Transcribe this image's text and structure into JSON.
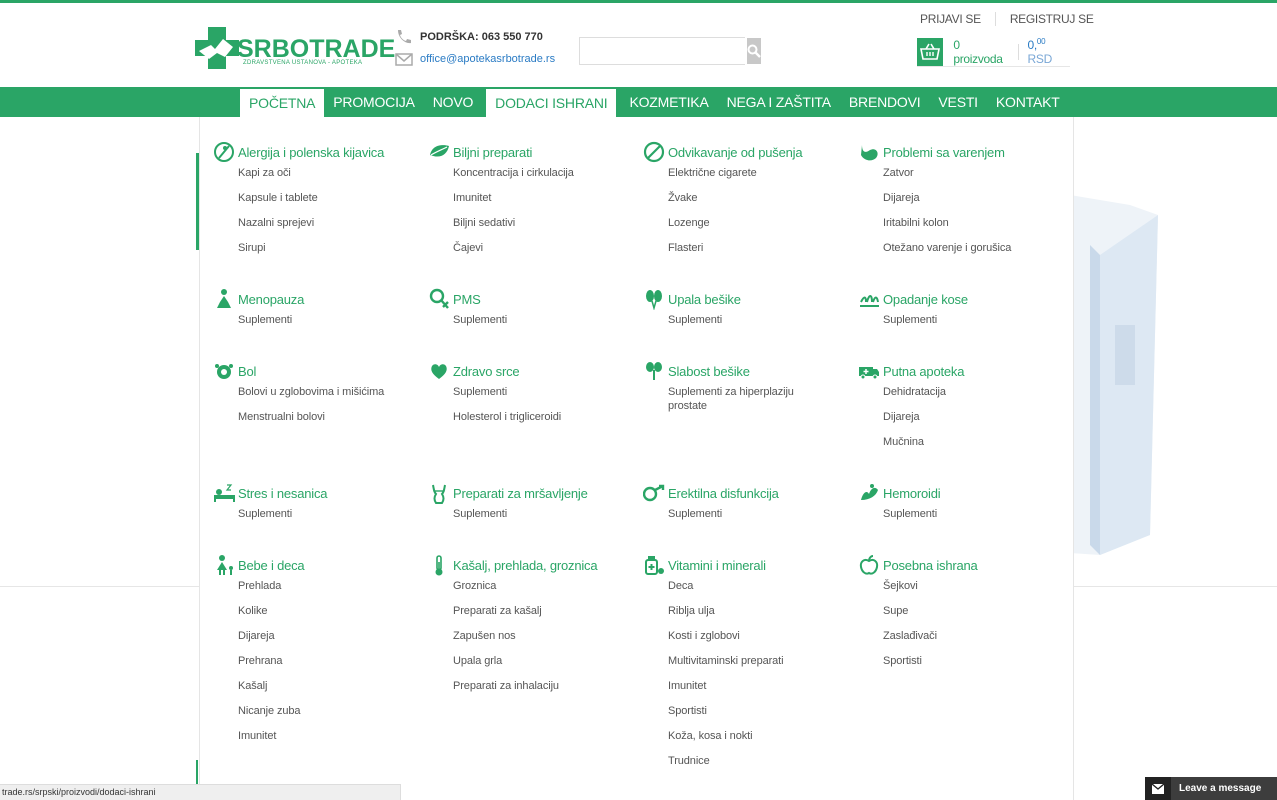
{
  "brand": {
    "name": "SRBOTRADE",
    "tagline": "ZDRAVSTVENA USTANOVA - APOTEKA"
  },
  "contact": {
    "support": "PODRŠKA: 063 550 770",
    "email": "office@apotekasrbotrade.rs"
  },
  "search": {
    "placeholder": ""
  },
  "auth": {
    "login": "PRIJAVI SE",
    "register": "REGISTRUJ SE"
  },
  "cart": {
    "count": "0 proizvoda",
    "price_int": "0,",
    "price_dec": "00",
    "currency": "RSD"
  },
  "nav": [
    "POČETNA",
    "PROMOCIJA",
    "NOVO",
    "DODACI ISHRANI",
    "KOZMETIKA",
    "NEGA I ZAŠTITA",
    "BRENDOVI",
    "VESTI",
    "KONTAKT"
  ],
  "categories": [
    {
      "title": "Alergija i polenska kijavica",
      "icon": "no-allergy-icon",
      "items": [
        "Kapi za oči",
        "Kapsule i tablete",
        "Nazalni sprejevi",
        "Sirupi"
      ]
    },
    {
      "title": "Biljni preparati",
      "icon": "leaf-icon",
      "items": [
        "Koncentracija i cirkulacija",
        "Imunitet",
        "Biljni sedativi",
        "Čajevi"
      ]
    },
    {
      "title": "Odvikavanje od pušenja",
      "icon": "no-smoking-icon",
      "items": [
        "Električne cigarete",
        "Žvake",
        "Lozenge",
        "Flasteri"
      ]
    },
    {
      "title": "Problemi sa varenjem",
      "icon": "stomach-icon",
      "items": [
        "Zatvor",
        "Dijareja",
        "Iritabilni kolon",
        "Otežano varenje i gorušica"
      ]
    },
    {
      "title": "Menopauza",
      "icon": "woman-icon",
      "items": [
        "Suplementi"
      ]
    },
    {
      "title": "PMS",
      "icon": "female-symbol-icon",
      "items": [
        "Suplementi"
      ]
    },
    {
      "title": "Upala bešike",
      "icon": "kidney-icon",
      "items": [
        "Suplementi"
      ]
    },
    {
      "title": "Opadanje kose",
      "icon": "hair-icon",
      "items": [
        "Suplementi"
      ]
    },
    {
      "title": "Bol",
      "icon": "pain-icon",
      "items": [
        "Bolovi u zglobovima i mišićima",
        "Menstrualni bolovi"
      ]
    },
    {
      "title": "Zdravo srce",
      "icon": "heart-hands-icon",
      "items": [
        "Suplementi",
        "Holesterol i trigliceroidi"
      ]
    },
    {
      "title": "Slabost bešike",
      "icon": "bladder-icon",
      "items": [
        "Suplementi za hiperplaziju prostate"
      ]
    },
    {
      "title": "Putna apoteka",
      "icon": "ambulance-icon",
      "items": [
        "Dehidratacija",
        "Dijareja",
        "Mučnina"
      ]
    },
    {
      "title": "Stres i nesanica",
      "icon": "sleep-icon",
      "items": [
        "Suplementi"
      ]
    },
    {
      "title": "Preparati za mršavljenje",
      "icon": "body-icon",
      "items": [
        "Suplementi"
      ]
    },
    {
      "title": "Erektilna disfunkcija",
      "icon": "male-symbol-icon",
      "items": [
        "Suplementi"
      ]
    },
    {
      "title": "Hemoroidi",
      "icon": "hemorrhoid-icon",
      "items": [
        "Suplementi"
      ]
    },
    {
      "title": "Bebe i deca",
      "icon": "child-icon",
      "items": [
        "Prehlada",
        "Kolike",
        "Dijareja",
        "Prehrana",
        "Kašalj",
        "Nicanje zuba",
        "Imunitet"
      ]
    },
    {
      "title": "Kašalj, prehlada, groznica",
      "icon": "thermometer-icon",
      "items": [
        "Groznica",
        "Preparati za kašalj",
        "Zapušen nos",
        "Upala grla",
        "Preparati za inhalaciju"
      ]
    },
    {
      "title": "Vitamini i minerali",
      "icon": "vitamin-bottle-icon",
      "items": [
        "Deca",
        "Riblja ulja",
        "Kosti i zglobovi",
        "Multivitaminski preparati",
        "Imunitet",
        "Sportisti",
        "Koža, kosa i nokti",
        "Trudnice"
      ]
    },
    {
      "title": "Posebna ishrana",
      "icon": "apple-icon",
      "items": [
        "Šejkovi",
        "Supe",
        "Zaslađivači",
        "Sportisti"
      ]
    }
  ],
  "status_url": "trade.rs/srpski/proizvodi/dodaci-ishrani",
  "chat": {
    "label": "Leave a message"
  },
  "colors": {
    "brand_green": "#2aa566",
    "link_blue": "#2a7bc4"
  }
}
